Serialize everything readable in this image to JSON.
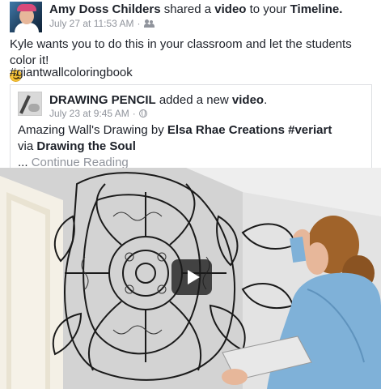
{
  "post": {
    "author": "Amy Doss Childers",
    "action_prefix": "shared a",
    "shared_type": "video",
    "action_suffix": "to your",
    "target": "Timeline.",
    "timestamp": "July 27 at 11:53 AM",
    "separator": "·",
    "privacy_icon": "friends-icon",
    "text": "Kyle wants you to do this in your classroom and let the students color it!",
    "emoji": "smiling-face-emoji",
    "hashtag": "#giantwallcoloringbook"
  },
  "shared_post": {
    "page_name": "DRAWING PENCIL",
    "action_prefix": "added a new",
    "content_type": "video",
    "action_suffix": ".",
    "timestamp": "July 23 at 9:45 AM",
    "separator": "·",
    "privacy_icon": "globe-icon",
    "body_prefix": "Amazing Wall's Drawing by",
    "body_author": "Elsa Rhae Creations",
    "body_hashtag": "#veriart",
    "via_prefix": "via",
    "via_page": "Drawing the Soul",
    "ellipsis": "...",
    "continue_reading": "Continue Reading"
  },
  "video": {
    "play_icon": "play-icon",
    "wall_color": "#d6d6d6",
    "ink_color": "#1a1a1a",
    "shirt_color": "#7fb1d8",
    "hair_color": "#a0632a"
  }
}
